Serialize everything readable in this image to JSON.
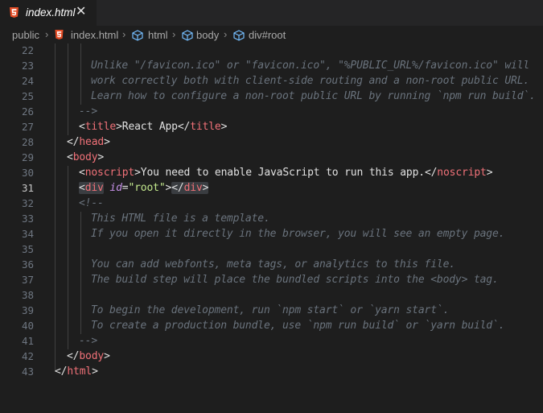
{
  "tab": {
    "label": "index.html",
    "close": "✕",
    "icon": "html5-icon"
  },
  "breadcrumb": {
    "items": [
      "public",
      "index.html",
      "html",
      "body",
      "div#root"
    ],
    "separator": "›"
  },
  "editor": {
    "active_line": "31",
    "lines": [
      {
        "n": "22",
        "text": ""
      },
      {
        "n": "23",
        "text": "Unlike \"/favicon.ico\" or \"favicon.ico\", \"%PUBLIC_URL%/favicon.ico\" will"
      },
      {
        "n": "24",
        "text": "work correctly both with client-side routing and a non-root public URL."
      },
      {
        "n": "25",
        "text": "Learn how to configure a non-root public URL by running `npm run build`."
      },
      {
        "n": "26",
        "text": "-->"
      },
      {
        "n": "27",
        "open_lt": "<",
        "open_tag": "title",
        "open_gt": ">",
        "inner": "React App",
        "close_lt": "</",
        "close_tag": "title",
        "close_gt": ">"
      },
      {
        "n": "28",
        "close_lt": "</",
        "close_tag": "head",
        "close_gt": ">"
      },
      {
        "n": "29",
        "open_lt": "<",
        "open_tag": "body",
        "open_gt": ">"
      },
      {
        "n": "30",
        "open_lt": "<",
        "open_tag": "noscript",
        "open_gt": ">",
        "inner": "You need to enable JavaScript to run this app.",
        "close_lt": "</",
        "close_tag": "noscript",
        "close_gt": ">"
      },
      {
        "n": "31",
        "open_lt": "<",
        "open_tag": "div",
        "attr": "id",
        "eq": "=",
        "val": "\"root\"",
        "open_gt": ">",
        "close_lt": "</",
        "close_tag": "div",
        "close_gt": ">"
      },
      {
        "n": "32",
        "text": "<!--"
      },
      {
        "n": "33",
        "text": "This HTML file is a template."
      },
      {
        "n": "34",
        "text": "If you open it directly in the browser, you will see an empty page."
      },
      {
        "n": "35",
        "text": ""
      },
      {
        "n": "36",
        "text": "You can add webfonts, meta tags, or analytics to this file."
      },
      {
        "n": "37",
        "text": "The build step will place the bundled scripts into the <body> tag."
      },
      {
        "n": "38",
        "text": ""
      },
      {
        "n": "39",
        "text": "To begin the development, run `npm start` or `yarn start`."
      },
      {
        "n": "40",
        "text": "To create a production bundle, use `npm run build` or `yarn build`."
      },
      {
        "n": "41",
        "text": "-->"
      },
      {
        "n": "42",
        "close_lt": "</",
        "close_tag": "body",
        "close_gt": ">"
      },
      {
        "n": "43",
        "close_lt": "</",
        "close_tag": "html",
        "close_gt": ">"
      }
    ]
  },
  "colors": {
    "background": "#1e1e1e",
    "tab_bar": "#252526",
    "html5_icon": "#e44d26",
    "tag": "#f07178",
    "attribute": "#c792ea",
    "string": "#c3e88d",
    "comment": "#6a737d",
    "line_number": "#6e7681"
  }
}
